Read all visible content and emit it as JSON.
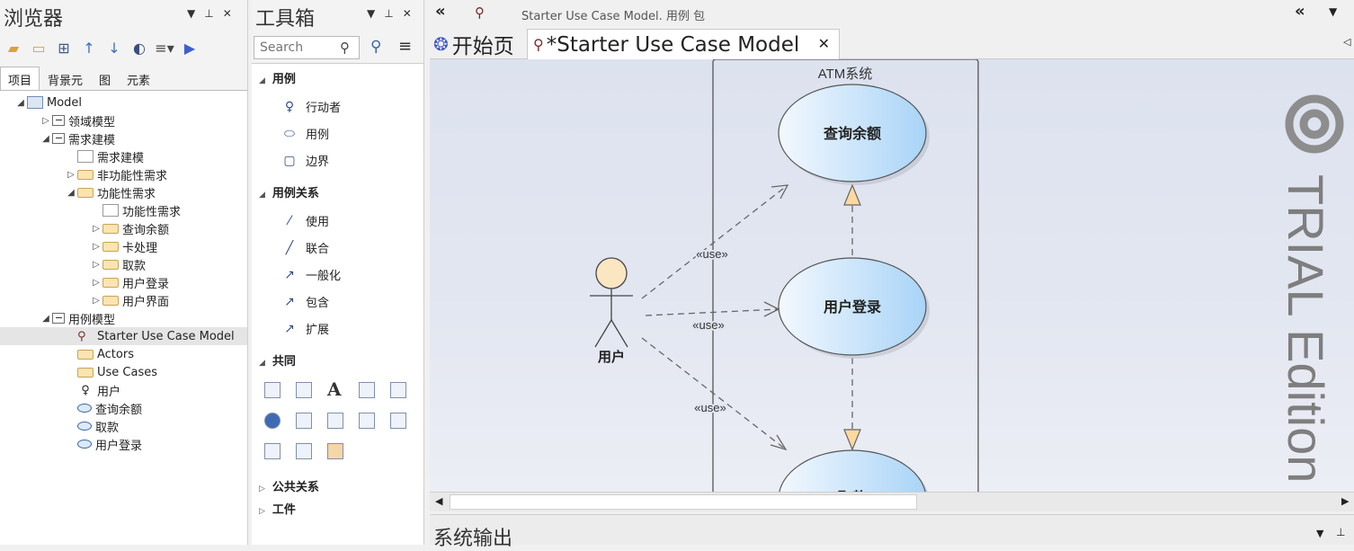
{
  "browser": {
    "title": "浏览器",
    "tabs": [
      "项目",
      "背景元",
      "图",
      "元素"
    ],
    "tree": [
      {
        "label": "Model",
        "depth": 0,
        "icon": "model",
        "exp": "open"
      },
      {
        "label": "领域模型",
        "depth": 1,
        "icon": "pkg",
        "exp": "closed"
      },
      {
        "label": "需求建模",
        "depth": 1,
        "icon": "pkg",
        "exp": "open"
      },
      {
        "label": "需求建模",
        "depth": 2,
        "icon": "diag",
        "exp": ""
      },
      {
        "label": "非功能性需求",
        "depth": 2,
        "icon": "folder",
        "exp": "closed"
      },
      {
        "label": "功能性需求",
        "depth": 2,
        "icon": "folder",
        "exp": "open"
      },
      {
        "label": "功能性需求",
        "depth": 3,
        "icon": "diag",
        "exp": ""
      },
      {
        "label": "查询余额",
        "depth": 3,
        "icon": "folder",
        "exp": "closed"
      },
      {
        "label": "卡处理",
        "depth": 3,
        "icon": "folder",
        "exp": "closed"
      },
      {
        "label": "取款",
        "depth": 3,
        "icon": "folder",
        "exp": "closed"
      },
      {
        "label": "用户登录",
        "depth": 3,
        "icon": "folder",
        "exp": "closed"
      },
      {
        "label": "用户界面",
        "depth": 3,
        "icon": "folder",
        "exp": "closed"
      },
      {
        "label": "用例模型",
        "depth": 1,
        "icon": "pkg",
        "exp": "open"
      },
      {
        "label": "Starter Use Case Model",
        "depth": 2,
        "icon": "usecase-diagram",
        "exp": "",
        "selected": true
      },
      {
        "label": "Actors",
        "depth": 2,
        "icon": "folder",
        "exp": ""
      },
      {
        "label": "Use Cases",
        "depth": 2,
        "icon": "folder",
        "exp": ""
      },
      {
        "label": "用户",
        "depth": 2,
        "icon": "actor",
        "exp": ""
      },
      {
        "label": "查询余额",
        "depth": 2,
        "icon": "ellipse",
        "exp": ""
      },
      {
        "label": "取款",
        "depth": 2,
        "icon": "ellipse",
        "exp": ""
      },
      {
        "label": "用户登录",
        "depth": 2,
        "icon": "ellipse",
        "exp": ""
      }
    ]
  },
  "toolbox": {
    "title": "工具箱",
    "search_placeholder": "Search",
    "sections": {
      "usecase": {
        "title": "用例",
        "items": [
          "行动者",
          "用例",
          "边界"
        ]
      },
      "relations": {
        "title": "用例关系",
        "items": [
          "使用",
          "联合",
          "一般化",
          "包含",
          "扩展"
        ]
      },
      "common": {
        "title": "共同"
      },
      "public_relations": {
        "title": "公共关系"
      },
      "artifacts": {
        "title": "工件"
      }
    }
  },
  "document": {
    "breadcrumb": "Starter Use Case Model.  用例 包",
    "tabs": [
      {
        "label": "开始页",
        "active": false
      },
      {
        "label": "*Starter Use Case Model",
        "active": true
      }
    ]
  },
  "diagram": {
    "boundary_label": "ATM系统",
    "actor_label": "用户",
    "usecases": [
      "查询余额",
      "用户登录",
      "取款"
    ],
    "stereotype": "«use»",
    "watermark": "TRIAL Edition"
  },
  "output": {
    "title": "系统输出"
  },
  "colors": {
    "usecase_fill": "#cfe6fb",
    "actor_head": "#fbe6c2",
    "canvas": "#dde2ef",
    "include_arrow": "#fcd9a0"
  }
}
